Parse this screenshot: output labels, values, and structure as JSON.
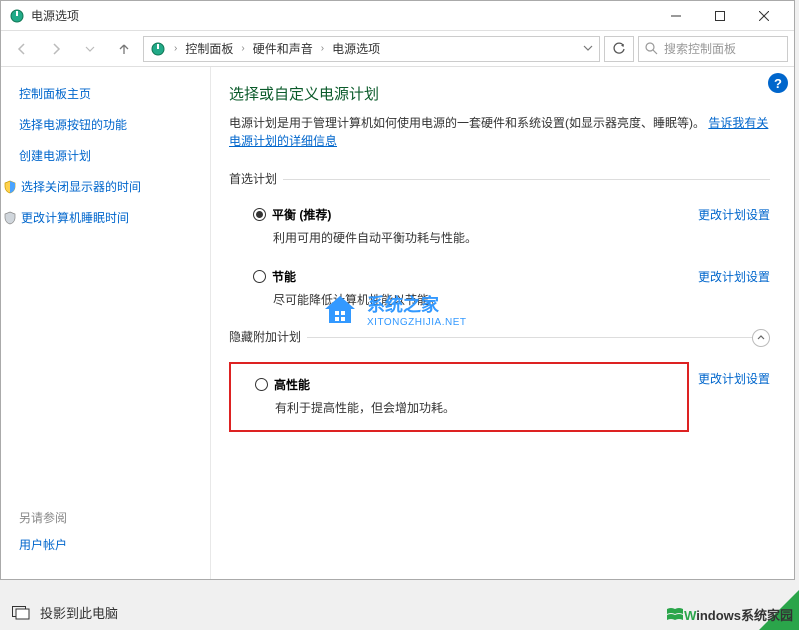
{
  "title": "电源选项",
  "breadcrumb": {
    "a": "控制面板",
    "b": "硬件和声音",
    "c": "电源选项"
  },
  "search": {
    "placeholder": "搜索控制面板"
  },
  "sidebar": {
    "heading": "控制面板主页",
    "link1": "选择电源按钮的功能",
    "link2": "创建电源计划",
    "link3": "选择关闭显示器的时间",
    "link4": "更改计算机睡眠时间",
    "see_also": "另请参阅",
    "user_accounts": "用户帐户"
  },
  "main": {
    "h1": "选择或自定义电源计划",
    "intro_text": "电源计划是用于管理计算机如何使用电源的一套硬件和系统设置(如显示器亮度、睡眠等)。",
    "intro_link": "告诉我有关电源计划的详细信息",
    "preferred_label": "首选计划",
    "hidden_label": "隐藏附加计划",
    "plan_balanced": {
      "name": "平衡 (推荐)",
      "desc": "利用可用的硬件自动平衡功耗与性能。"
    },
    "plan_saver": {
      "name": "节能",
      "desc": "尽可能降低计算机性能以节能。"
    },
    "plan_high": {
      "name": "高性能",
      "desc": "有利于提高性能，但会增加功耗。"
    },
    "change_link": "更改计划设置"
  },
  "watermark": {
    "cn": "系统之家",
    "en": "XITONGZHIJIA.NET"
  },
  "taskbar": {
    "project": "投影到此电脑"
  },
  "brand": {
    "w": "W",
    "rest": "indows系统家园"
  }
}
